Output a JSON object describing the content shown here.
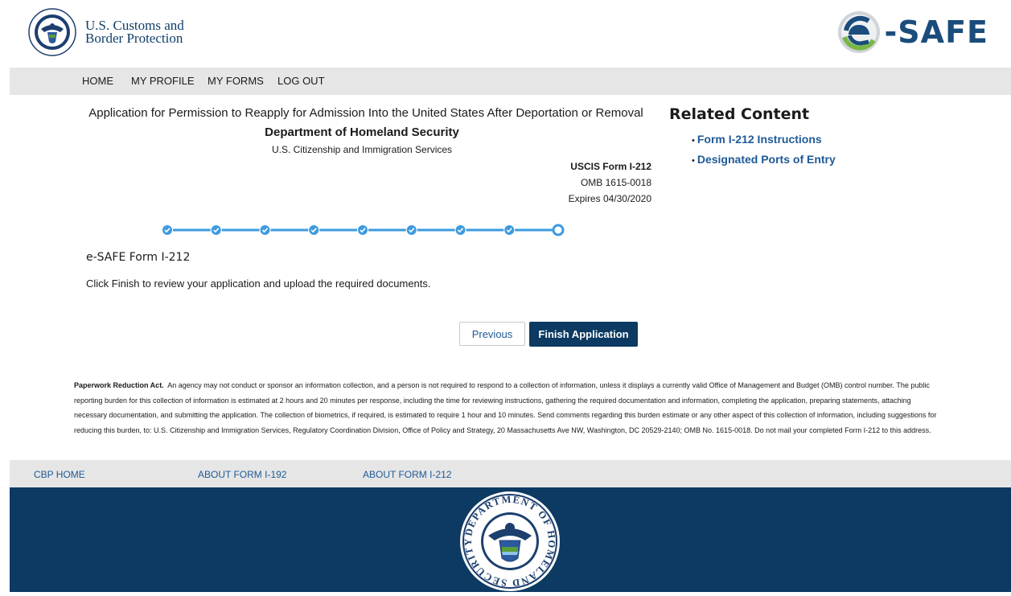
{
  "header": {
    "agency_line1": "U.S. Customs and",
    "agency_line2": "Border Protection",
    "logo_text": "-SAFE",
    "seal_ring_text": "DEPARTMENT OF HOMELAND SECURITY"
  },
  "nav": {
    "items": [
      "HOME",
      "MY PROFILE",
      "MY FORMS",
      "LOG OUT"
    ]
  },
  "form_header": {
    "title": "Application for Permission to Reapply for Admission Into the United States After Deportation or Removal",
    "department": "Department of Homeland Security",
    "agency": "U.S. Citizenship and Immigration Services",
    "form_number": "USCIS Form I-212",
    "omb": "OMB 1615-0018",
    "expires": "Expires 04/30/2020"
  },
  "related": {
    "heading": "Related Content",
    "links": [
      "Form I-212 Instructions",
      "Designated Ports of Entry"
    ]
  },
  "stepper": {
    "total_steps": 9,
    "completed_steps": 8,
    "current_step": 9
  },
  "content": {
    "form_name": "e-SAFE Form I-212",
    "instruction": "Click Finish to review your application and upload the required documents."
  },
  "buttons": {
    "previous": "Previous",
    "finish": "Finish Application"
  },
  "paperwork": {
    "label": "Paperwork Reduction Act.",
    "text": "An agency may not conduct or sponsor an information collection, and a person is not required to respond to a collection of information, unless it displays a currently valid Office of Management and Budget (OMB) control number.  The public reporting burden for this collection of information is estimated at 2 hours and 20 minutes per response, including the time for reviewing instructions, gathering the required documentation and information, completing the application, preparing statements, attaching necessary documentation, and submitting the application.  The collection of biometrics, if required, is estimated to require 1 hour and 10 minutes.  Send comments regarding this burden estimate or any other aspect of this collection of information, including suggestions for reducing this burden, to:  U.S. Citizenship and Immigration Services, Regulatory Coordination Division, Office of Policy and Strategy, 20 Massachusetts Ave NW, Washington, DC 20529-2140; OMB No. 1615-0018.  Do not mail your completed Form I-212 to this address."
  },
  "footer": {
    "links": [
      "CBP HOME",
      "ABOUT FORM I-192",
      "ABOUT FORM I-212"
    ]
  },
  "colors": {
    "navy": "#0c3a62",
    "link": "#1e5a96",
    "step": "#3d9be0",
    "nav_bg": "#e6e6e6",
    "logo_green": "#7ab648"
  }
}
